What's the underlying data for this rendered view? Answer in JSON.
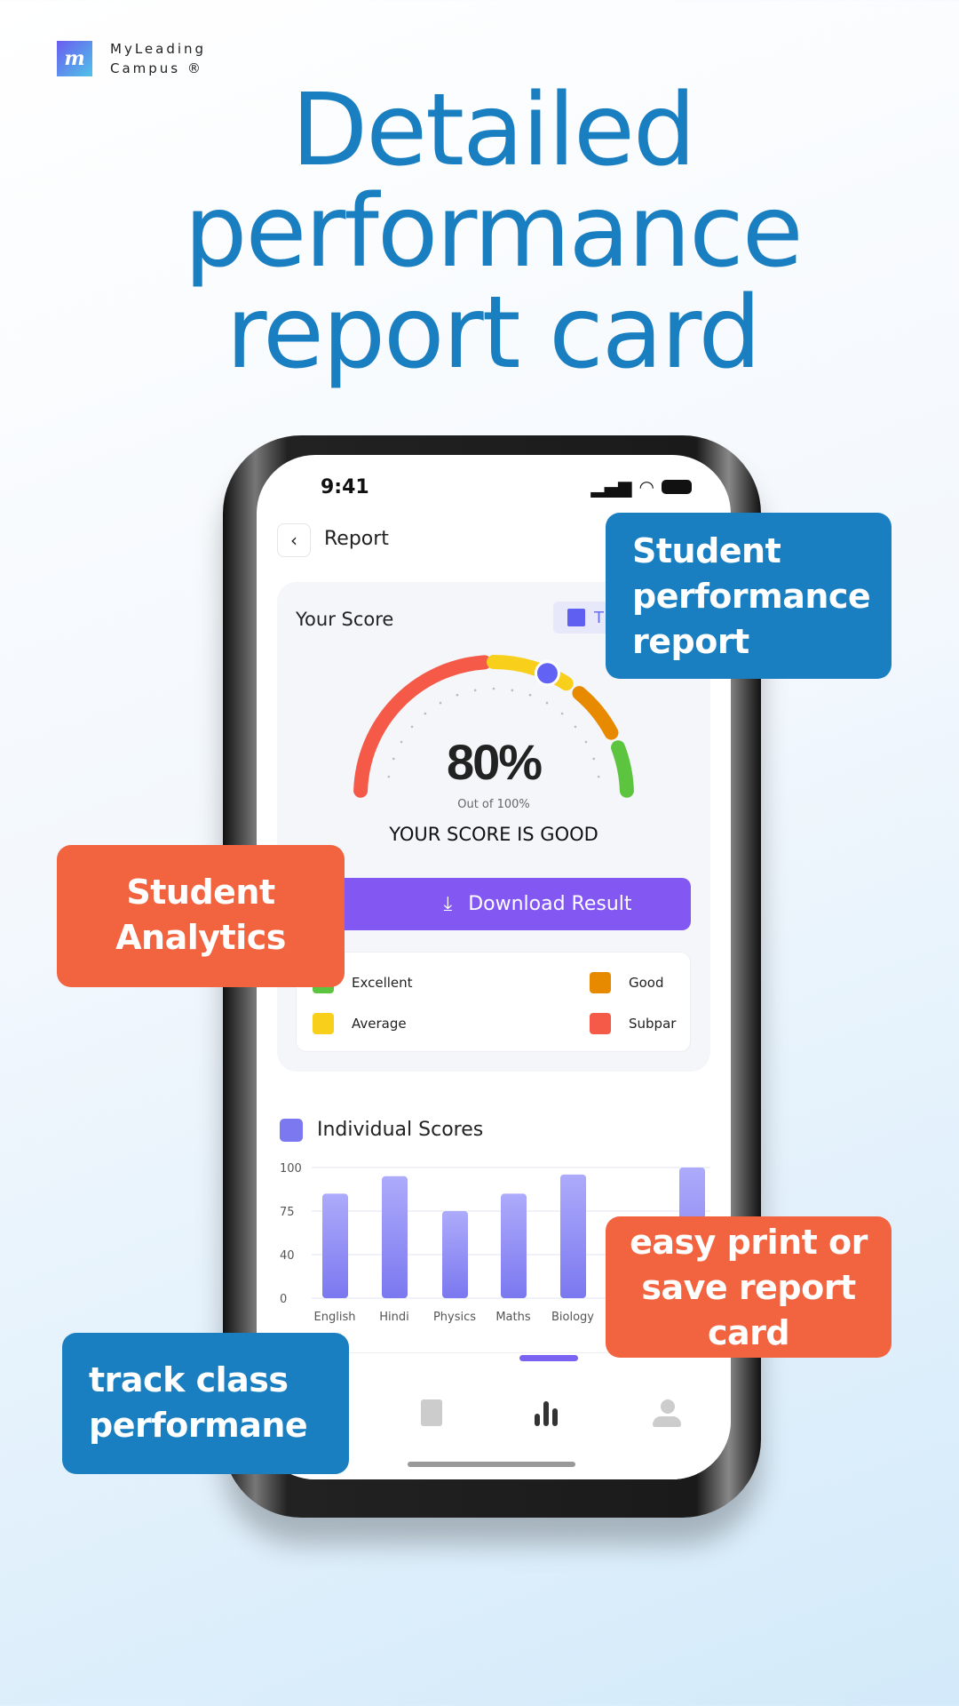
{
  "brand": {
    "logo_letter": "m",
    "line1": "MyLeading",
    "line2": "Campus ®"
  },
  "headline": [
    "Detailed",
    "performance",
    "report card"
  ],
  "phone": {
    "status": {
      "time": "9:41"
    },
    "header": {
      "title": "Report"
    },
    "score_card": {
      "title": "Your Score",
      "chip_label": "T",
      "score": 80,
      "score_text": "80%",
      "out_of": "Out of 100%",
      "verdict": "YOUR SCORE IS GOOD",
      "download_label": "Download Result"
    },
    "legend": [
      {
        "label": "Excellent",
        "color": "#5dc43f"
      },
      {
        "label": "Good",
        "color": "#e88a00"
      },
      {
        "label": "Average",
        "color": "#f8cf1a"
      },
      {
        "label": "Subpar",
        "color": "#f55a48"
      }
    ],
    "individual_scores": {
      "title": "Individual Scores"
    },
    "nav": {
      "active": "analytics"
    }
  },
  "chart_data": {
    "type": "bar",
    "categories": [
      "English",
      "Hindi",
      "Physics",
      "Maths",
      "Biology",
      "",
      ""
    ],
    "values": [
      85,
      95,
      75,
      85,
      96,
      null,
      100
    ],
    "yticks": [
      0,
      40,
      75,
      100
    ],
    "ylim": [
      0,
      100
    ],
    "grid": true,
    "bar_color": "#7b78f0"
  },
  "callouts": {
    "report": "Student performance report",
    "analytics": "Student Analytics",
    "print": "easy print or save report card",
    "track": "track class performane"
  }
}
